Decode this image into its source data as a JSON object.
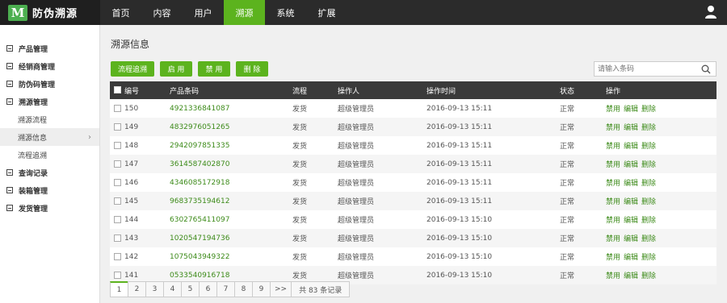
{
  "brand": {
    "mark": "M",
    "name": "防伪溯源"
  },
  "nav": [
    "首页",
    "内容",
    "用户",
    "溯源",
    "系统",
    "扩展"
  ],
  "sidebar": {
    "groups": [
      {
        "label": "产品管理"
      },
      {
        "label": "经销商管理"
      },
      {
        "label": "防伪码管理"
      },
      {
        "label": "溯源管理",
        "children": [
          "溯源流程",
          "溯源信息",
          "流程追溯"
        ]
      },
      {
        "label": "查询记录"
      },
      {
        "label": "装箱管理"
      },
      {
        "label": "发货管理"
      }
    ]
  },
  "page": {
    "title": "溯源信息"
  },
  "toolbar": {
    "trace": "流程追溯",
    "enable": "启 用",
    "disable": "禁 用",
    "delete": "删 除"
  },
  "search": {
    "placeholder": "请输入条码"
  },
  "table": {
    "headers": [
      "编号",
      "产品条码",
      "流程",
      "操作人",
      "操作时间",
      "状态",
      "操作"
    ],
    "actions": [
      "禁用",
      "编辑",
      "删除"
    ],
    "rows": [
      {
        "id": "150",
        "code": "4921336841087",
        "flow": "发货",
        "operator": "超级管理员",
        "time": "2016-09-13 15:11",
        "status": "正常"
      },
      {
        "id": "149",
        "code": "4832976051265",
        "flow": "发货",
        "operator": "超级管理员",
        "time": "2016-09-13 15:11",
        "status": "正常"
      },
      {
        "id": "148",
        "code": "2942097851335",
        "flow": "发货",
        "operator": "超级管理员",
        "time": "2016-09-13 15:11",
        "status": "正常"
      },
      {
        "id": "147",
        "code": "3614587402870",
        "flow": "发货",
        "operator": "超级管理员",
        "time": "2016-09-13 15:11",
        "status": "正常"
      },
      {
        "id": "146",
        "code": "4346085172918",
        "flow": "发货",
        "operator": "超级管理员",
        "time": "2016-09-13 15:11",
        "status": "正常"
      },
      {
        "id": "145",
        "code": "9683735194612",
        "flow": "发货",
        "operator": "超级管理员",
        "time": "2016-09-13 15:11",
        "status": "正常"
      },
      {
        "id": "144",
        "code": "6302765411097",
        "flow": "发货",
        "operator": "超级管理员",
        "time": "2016-09-13 15:10",
        "status": "正常"
      },
      {
        "id": "143",
        "code": "1020547194736",
        "flow": "发货",
        "operator": "超级管理员",
        "time": "2016-09-13 15:10",
        "status": "正常"
      },
      {
        "id": "142",
        "code": "1075043949322",
        "flow": "发货",
        "operator": "超级管理员",
        "time": "2016-09-13 15:10",
        "status": "正常"
      },
      {
        "id": "141",
        "code": "0533540916718",
        "flow": "发货",
        "operator": "超级管理员",
        "time": "2016-09-13 15:10",
        "status": "正常"
      }
    ]
  },
  "pager": {
    "pages": [
      "1",
      "2",
      "3",
      "4",
      "5",
      "6",
      "7",
      "8",
      "9"
    ],
    "next": ">>",
    "total": "共 83 条记录"
  },
  "colors": {
    "accent": "#5cb31e",
    "topbar": "#2b2b2b",
    "header": "#3a3a3a",
    "link": "#3d8b1a"
  }
}
